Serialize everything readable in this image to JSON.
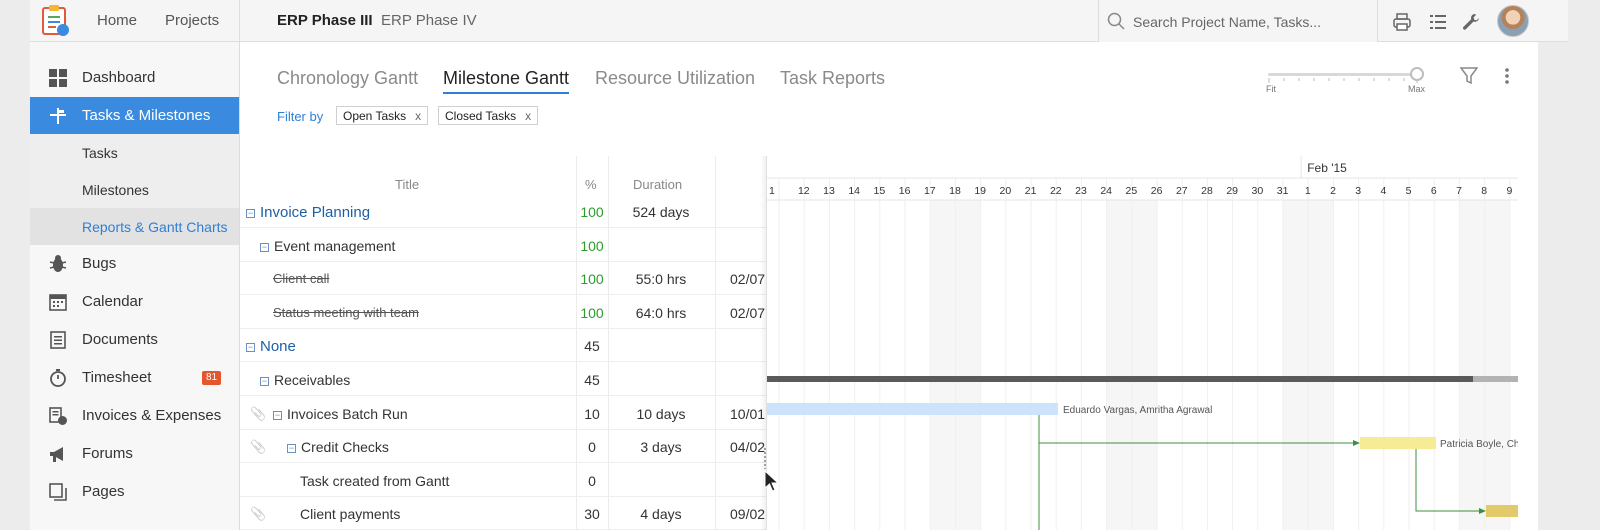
{
  "topbar": {
    "nav": [
      "Home",
      "Projects"
    ],
    "projects": [
      {
        "label": "ERP Phase III",
        "active": true
      },
      {
        "label": "ERP Phase IV",
        "active": false
      }
    ],
    "search_placeholder": "Search Project Name, Tasks...",
    "icons": [
      "print-icon",
      "list-icon",
      "wrench-icon"
    ]
  },
  "sidebar": {
    "items": [
      {
        "label": "Dashboard",
        "icon": "dashboard-icon"
      },
      {
        "label": "Tasks & Milestones",
        "icon": "tasks-icon",
        "active": true
      },
      {
        "label": "Bugs",
        "icon": "bug-icon"
      },
      {
        "label": "Calendar",
        "icon": "calendar-icon"
      },
      {
        "label": "Documents",
        "icon": "documents-icon"
      },
      {
        "label": "Timesheet",
        "icon": "timesheet-icon",
        "badge": "81"
      },
      {
        "label": "Invoices & Expenses",
        "icon": "invoice-icon"
      },
      {
        "label": "Forums",
        "icon": "megaphone-icon"
      },
      {
        "label": "Pages",
        "icon": "pages-icon"
      }
    ],
    "subitems": [
      {
        "label": "Tasks"
      },
      {
        "label": "Milestones"
      },
      {
        "label": "Reports & Gantt Charts",
        "selected": true
      }
    ]
  },
  "tabs": [
    {
      "label": "Chronology Gantt",
      "active": false
    },
    {
      "label": "Milestone Gantt",
      "active": true
    },
    {
      "label": "Resource Utilization",
      "active": false
    },
    {
      "label": "Task Reports",
      "active": false
    }
  ],
  "filter": {
    "label": "Filter by",
    "chips": [
      "Open Tasks",
      "Closed Tasks"
    ],
    "remove_glyph": "x"
  },
  "zoom": {
    "min_label": "Fit",
    "max_label": "Max",
    "level": 1.0
  },
  "grid": {
    "headers": {
      "title": "Title",
      "pct": "%",
      "duration": "Duration"
    },
    "rows": [
      {
        "title": "Invoice Planning",
        "level": 0,
        "group": true,
        "collapsible": true,
        "pct": "100",
        "duration": "524 days",
        "start": ""
      },
      {
        "title": "Event management",
        "level": 1,
        "group": false,
        "collapsible": true,
        "pct": "100",
        "duration": "",
        "start": ""
      },
      {
        "title": "Client call",
        "level": 2,
        "strike": true,
        "pct": "100",
        "duration": "55:0 hrs",
        "start": "02/07"
      },
      {
        "title": "Status meeting with team",
        "level": 2,
        "strike": true,
        "pct": "100",
        "duration": "64:0 hrs",
        "start": "02/07"
      },
      {
        "title": "None",
        "level": 0,
        "group": true,
        "collapsible": true,
        "pct": "45",
        "duration": "",
        "start": ""
      },
      {
        "title": "Receivables",
        "level": 1,
        "collapsible": true,
        "pct": "45",
        "duration": "",
        "start": ""
      },
      {
        "title": "Invoices Batch Run",
        "level": 2,
        "collapsible": true,
        "attach": true,
        "pct": "10",
        "duration": "10 days",
        "start": "10/01"
      },
      {
        "title": "Credit Checks",
        "level": 3,
        "collapsible": true,
        "attach": true,
        "pct": "0",
        "duration": "3 days",
        "start": "04/02"
      },
      {
        "title": "Task created from Gantt",
        "level": 3,
        "pct": "0",
        "duration": "",
        "start": ""
      },
      {
        "title": "Client payments",
        "level": 3,
        "attach": true,
        "pct": "30",
        "duration": "4 days",
        "start": "09/02"
      }
    ]
  },
  "gantt": {
    "month_label": "Feb '15",
    "days": [
      "1",
      "12",
      "13",
      "14",
      "15",
      "16",
      "17",
      "18",
      "19",
      "20",
      "21",
      "22",
      "23",
      "24",
      "25",
      "26",
      "27",
      "28",
      "29",
      "30",
      "31",
      "1",
      "2",
      "3",
      "4",
      "5",
      "6",
      "7",
      "8",
      "9"
    ],
    "bar_labels": {
      "batch_run": "Eduardo Vargas, Amritha Agrawal",
      "credit_checks": "Patricia Boyle, Ch"
    }
  },
  "colors": {
    "accent": "#3a8ae0",
    "badge": "#e4562b",
    "pct_complete": "#2e9b2e",
    "bar_blue": "#cde3fb",
    "bar_yellow": "#f5ec95",
    "bar_gold": "#e2c96a",
    "dependency": "#3f8f3f"
  }
}
